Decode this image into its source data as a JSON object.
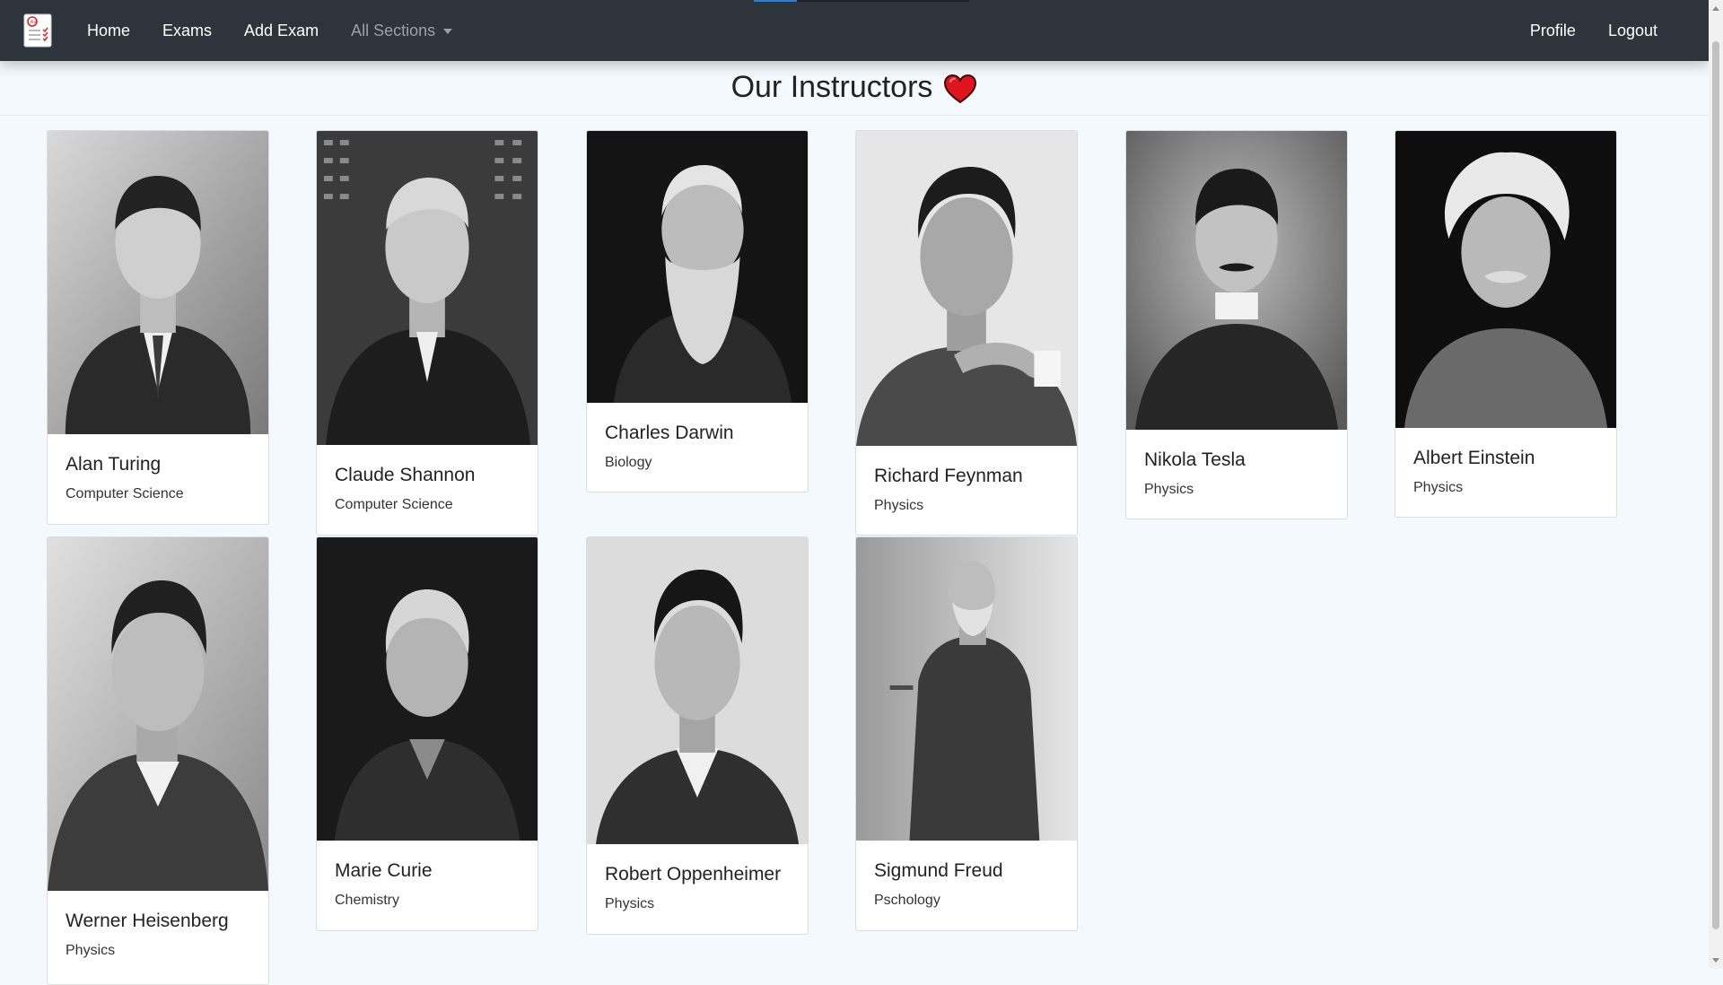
{
  "navbar": {
    "logo_icon": "exam-sheet-logo-icon",
    "links": [
      "Home",
      "Exams",
      "Add Exam"
    ],
    "sections_dropdown": "All Sections",
    "right_links": [
      "Profile",
      "Logout"
    ]
  },
  "page": {
    "title": "Our Instructors",
    "title_icon": "heart-icon"
  },
  "instructors": [
    {
      "name": "Alan Turing",
      "subject": "Computer Science"
    },
    {
      "name": "Claude Shannon",
      "subject": "Computer Science"
    },
    {
      "name": "Charles Darwin",
      "subject": "Biology"
    },
    {
      "name": "Richard Feynman",
      "subject": "Physics"
    },
    {
      "name": "Nikola Tesla",
      "subject": "Physics"
    },
    {
      "name": "Albert Einstein",
      "subject": "Physics"
    },
    {
      "name": "Werner Heisenberg",
      "subject": "Physics"
    },
    {
      "name": "Marie Curie",
      "subject": "Chemistry"
    },
    {
      "name": "Robert Oppenheimer",
      "subject": "Physics"
    },
    {
      "name": "Sigmund Freud",
      "subject": "Pschology"
    }
  ],
  "colors": {
    "navbar_bg": "#2e343b",
    "page_bg": "#f3f9fd",
    "heart": "#e0141e"
  }
}
